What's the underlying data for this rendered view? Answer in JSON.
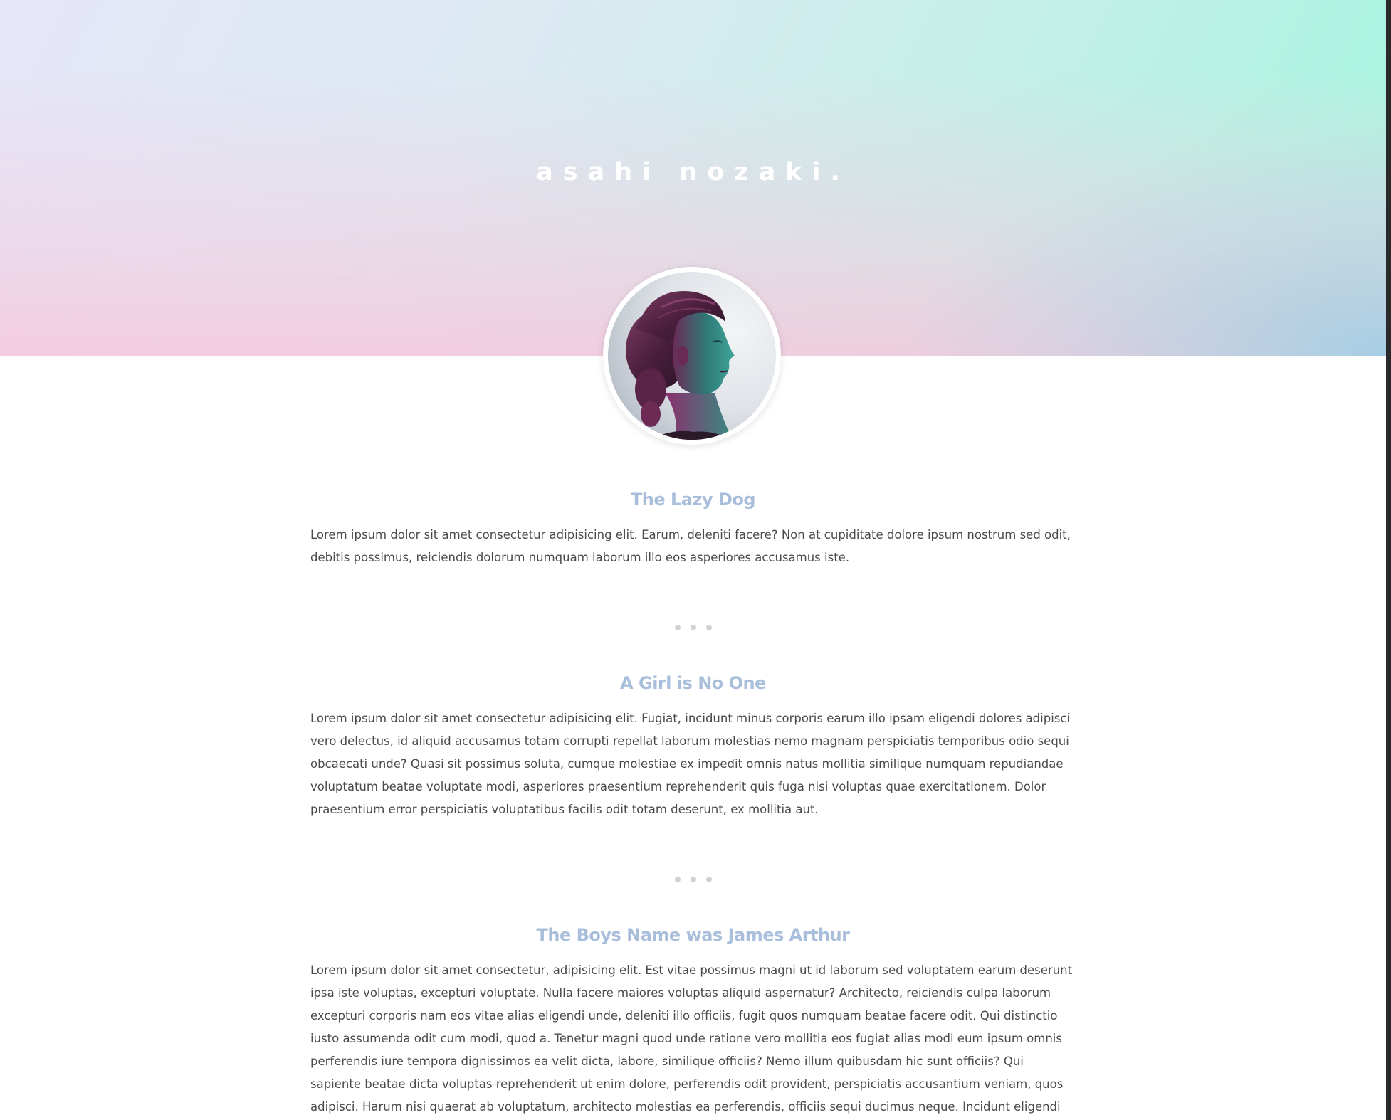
{
  "header": {
    "site_title": "asahi nozaki."
  },
  "avatar": {
    "icon": "profile-photo"
  },
  "colors": {
    "title_accent": "#a9bedb",
    "body_text": "#4a4a4a",
    "separator_dot": "#d2d2d2"
  },
  "sections": [
    {
      "title": "The Lazy Dog",
      "text": "Lorem ipsum dolor sit amet consectetur adipisicing elit. Earum, deleniti facere? Non at cupiditate dolore ipsum nostrum sed odit, debitis possimus, reiciendis dolorum numquam laborum illo eos asperiores accusamus iste."
    },
    {
      "title": "A Girl is No One",
      "text": "Lorem ipsum dolor sit amet consectetur adipisicing elit. Fugiat, incidunt minus corporis earum illo ipsam eligendi dolores adipisci vero delectus, id aliquid accusamus totam corrupti repellat laborum molestias nemo magnam perspiciatis temporibus odio sequi obcaecati unde? Quasi sit possimus soluta, cumque molestiae ex impedit omnis natus mollitia similique numquam repudiandae voluptatum beatae voluptate modi, asperiores praesentium reprehenderit quis fuga nisi voluptas quae exercitationem. Dolor praesentium error perspiciatis voluptatibus facilis odit totam deserunt, ex mollitia aut."
    },
    {
      "title": "The Boys Name was James Arthur",
      "text": "Lorem ipsum dolor sit amet consectetur, adipisicing elit. Est vitae possimus magni ut id laborum sed voluptatem earum deserunt ipsa iste voluptas, excepturi voluptate. Nulla facere maiores voluptas aliquid aspernatur? Architecto, reiciendis culpa laborum excepturi corporis nam eos vitae alias eligendi unde, deleniti illo officiis, fugit quos numquam beatae facere odit. Qui distinctio iusto assumenda odit cum modi, quod a. Tenetur magni quod unde ratione vero mollitia eos fugiat alias modi eum ipsum omnis perferendis iure tempora dignissimos ea velit dicta, labore, similique officiis? Nemo illum quibusdam hic sunt officiis? Qui sapiente beatae dicta voluptas reprehenderit ut enim dolore, perferendis odit provident, perspiciatis accusantium veniam, quos adipisci. Harum nisi quaerat ab voluptatum, architecto molestias ea perferendis, officiis sequi ducimus neque. Incidunt eligendi velit est odio, sit, quae provident"
    }
  ]
}
